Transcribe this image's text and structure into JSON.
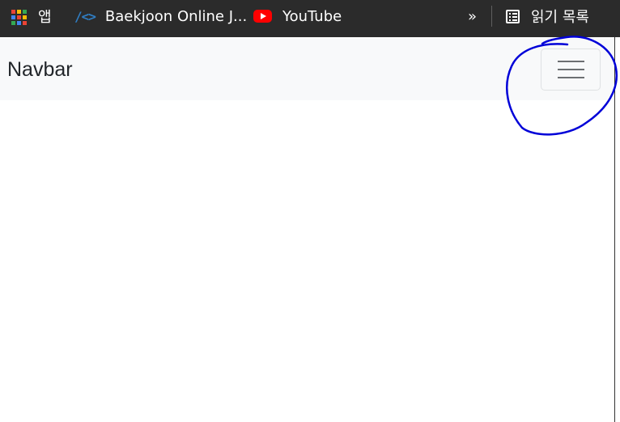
{
  "bookmarks_bar": {
    "apps": {
      "label": "앱",
      "icon": "apps-grid-icon"
    },
    "items": [
      {
        "label": "Baekjoon Online J...",
        "icon": "code-brackets-icon"
      },
      {
        "label": "YouTube",
        "icon": "youtube-icon"
      }
    ],
    "overflow_label": "»",
    "reading_list": {
      "label": "읽기 목록",
      "icon": "reading-list-icon"
    }
  },
  "page": {
    "navbar": {
      "brand": "Navbar",
      "toggler_icon": "hamburger-menu-icon"
    }
  },
  "annotation": {
    "color": "#0000d8",
    "shape": "hand-drawn-circle",
    "target": "navbar-toggler"
  },
  "colors": {
    "bookmarks_bg": "#2b2b2b",
    "navbar_bg": "#f8f9fa",
    "brand_text": "#212529",
    "youtube_red": "#ff0000",
    "annotation_blue": "#0000d8"
  }
}
